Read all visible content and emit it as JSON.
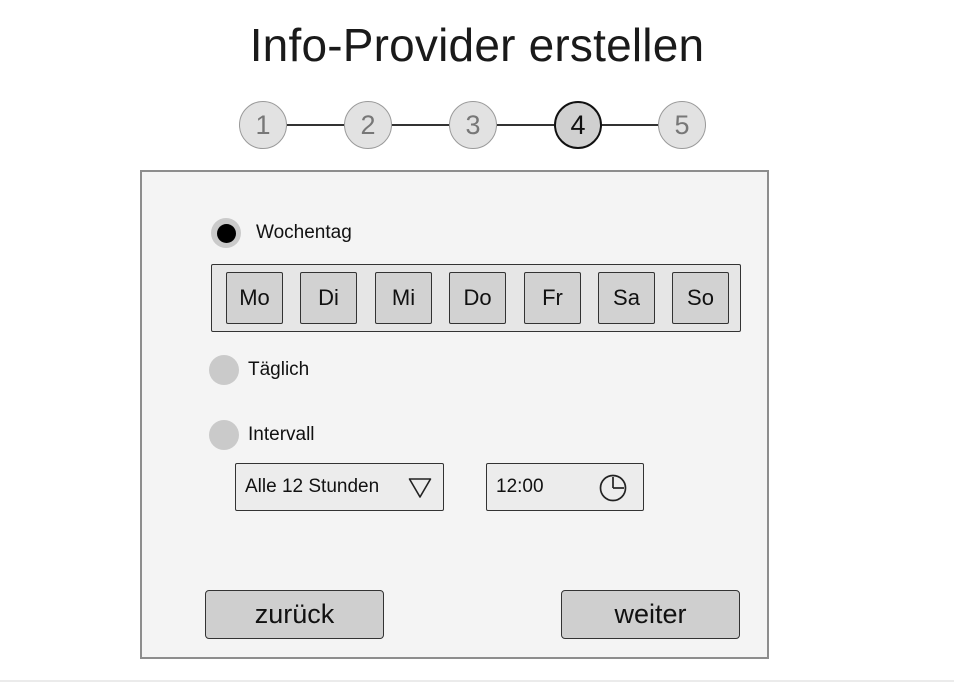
{
  "header": {
    "title": "Info-Provider erstellen"
  },
  "stepper": {
    "steps": [
      "1",
      "2",
      "3",
      "4",
      "5"
    ],
    "active_step": "4"
  },
  "schedule": {
    "options": {
      "weekday": {
        "label": "Wochentag",
        "selected": true
      },
      "daily": {
        "label": "Täglich",
        "selected": false
      },
      "interval": {
        "label": "Intervall",
        "selected": false
      }
    },
    "days": [
      "Mo",
      "Di",
      "Mi",
      "Do",
      "Fr",
      "Sa",
      "So"
    ],
    "interval_select": {
      "value": "Alle 12 Stunden",
      "icon": "triangle-down-icon"
    },
    "time_input": {
      "value": "12:00",
      "icon": "clock-icon"
    }
  },
  "actions": {
    "back_label": "zurück",
    "next_label": "weiter"
  },
  "colors": {
    "panel_bg": "#f4f4f4",
    "panel_border": "#8d8d8d",
    "button_bg": "#cfcfcf",
    "step_inactive_bg": "#e2e2e2",
    "step_active_bg": "#d0d0d0",
    "radio_bg": "#cacaca",
    "radio_selected": "#000000"
  }
}
